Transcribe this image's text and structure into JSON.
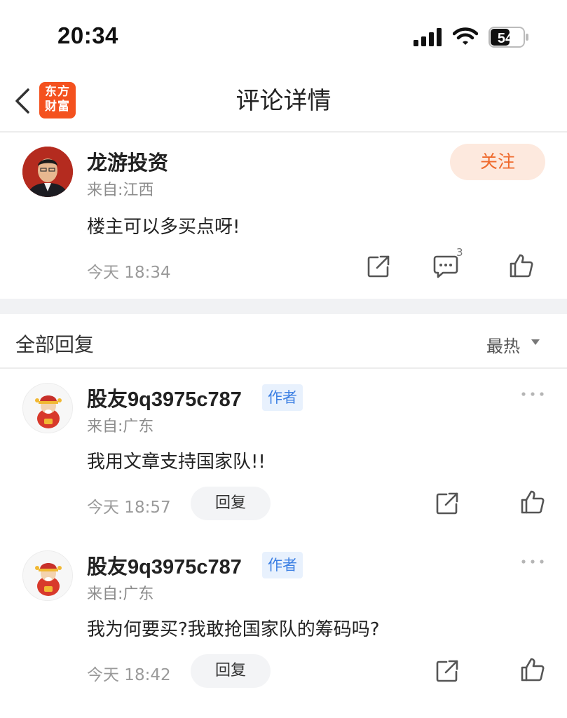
{
  "status_bar": {
    "time": "20:34",
    "battery": "54"
  },
  "nav": {
    "logo_line1": "东方",
    "logo_line2": "财富",
    "title": "评论详情"
  },
  "main_comment": {
    "user_name": "龙游投资",
    "location": "来自:江西",
    "follow_label": "关注",
    "text": "楼主可以多买点呀!",
    "time": "今天 18:34",
    "comment_count": "3"
  },
  "replies_section": {
    "title": "全部回复",
    "sort_label": "最热"
  },
  "replies": [
    {
      "user_name": "股友9q3975c787",
      "badge": "作者",
      "location": "来自:广东",
      "text": "我用文章支持国家队!!",
      "time": "今天 18:57",
      "reply_label": "回复"
    },
    {
      "user_name": "股友9q3975c787",
      "badge": "作者",
      "location": "来自:广东",
      "text": "我为何要买?我敢抢国家队的筹码吗?",
      "time": "今天 18:42",
      "reply_label": "回复"
    }
  ],
  "colors": {
    "accent": "#ef6a2d",
    "follow_bg": "#fde9de",
    "badge_text": "#3b7fe3",
    "badge_bg": "#e8f1fd"
  }
}
